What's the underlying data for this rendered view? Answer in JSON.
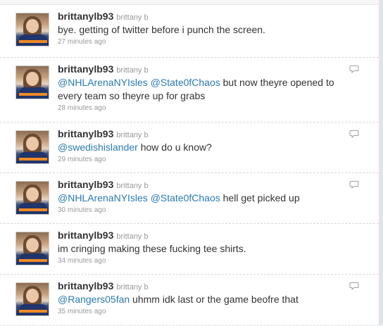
{
  "tweets": [
    {
      "screen_name": "brittanylb93",
      "full_name": "brittany b",
      "segments": [
        {
          "type": "text",
          "text": "bye. getting of twitter before i punch the screen."
        }
      ],
      "timestamp": "27 minutes ago",
      "reply_icon": false
    },
    {
      "screen_name": "brittanylb93",
      "full_name": "brittany b",
      "segments": [
        {
          "type": "mention",
          "text": "@NHLArenaNYIsles"
        },
        {
          "type": "text",
          "text": " "
        },
        {
          "type": "mention",
          "text": "@State0fChaos"
        },
        {
          "type": "text",
          "text": " but now theyre opened to every team so theyre up for grabs"
        }
      ],
      "timestamp": "28 minutes ago",
      "reply_icon": true
    },
    {
      "screen_name": "brittanylb93",
      "full_name": "brittany b",
      "segments": [
        {
          "type": "mention",
          "text": "@swedishislander"
        },
        {
          "type": "text",
          "text": " how do u know?"
        }
      ],
      "timestamp": "29 minutes ago",
      "reply_icon": true
    },
    {
      "screen_name": "brittanylb93",
      "full_name": "brittany b",
      "segments": [
        {
          "type": "mention",
          "text": "@NHLArenaNYIsles"
        },
        {
          "type": "text",
          "text": " "
        },
        {
          "type": "mention",
          "text": "@State0fChaos"
        },
        {
          "type": "text",
          "text": " hell get picked up"
        }
      ],
      "timestamp": "30 minutes ago",
      "reply_icon": true
    },
    {
      "screen_name": "brittanylb93",
      "full_name": "brittany b",
      "segments": [
        {
          "type": "text",
          "text": "im cringing making these fucking tee shirts."
        }
      ],
      "timestamp": "34 minutes ago",
      "reply_icon": false
    },
    {
      "screen_name": "brittanylb93",
      "full_name": "brittany b",
      "segments": [
        {
          "type": "mention",
          "text": "@Rangers05fan"
        },
        {
          "type": "text",
          "text": " uhmm idk last or the game beofre that"
        }
      ],
      "timestamp": "35 minutes ago",
      "reply_icon": true
    }
  ],
  "colors": {
    "mention": "#2a7ab0",
    "text": "#333333",
    "meta": "#999999"
  },
  "icons": {
    "reply": "reply-speech-bubble-icon",
    "avatar": "profile-photo"
  }
}
